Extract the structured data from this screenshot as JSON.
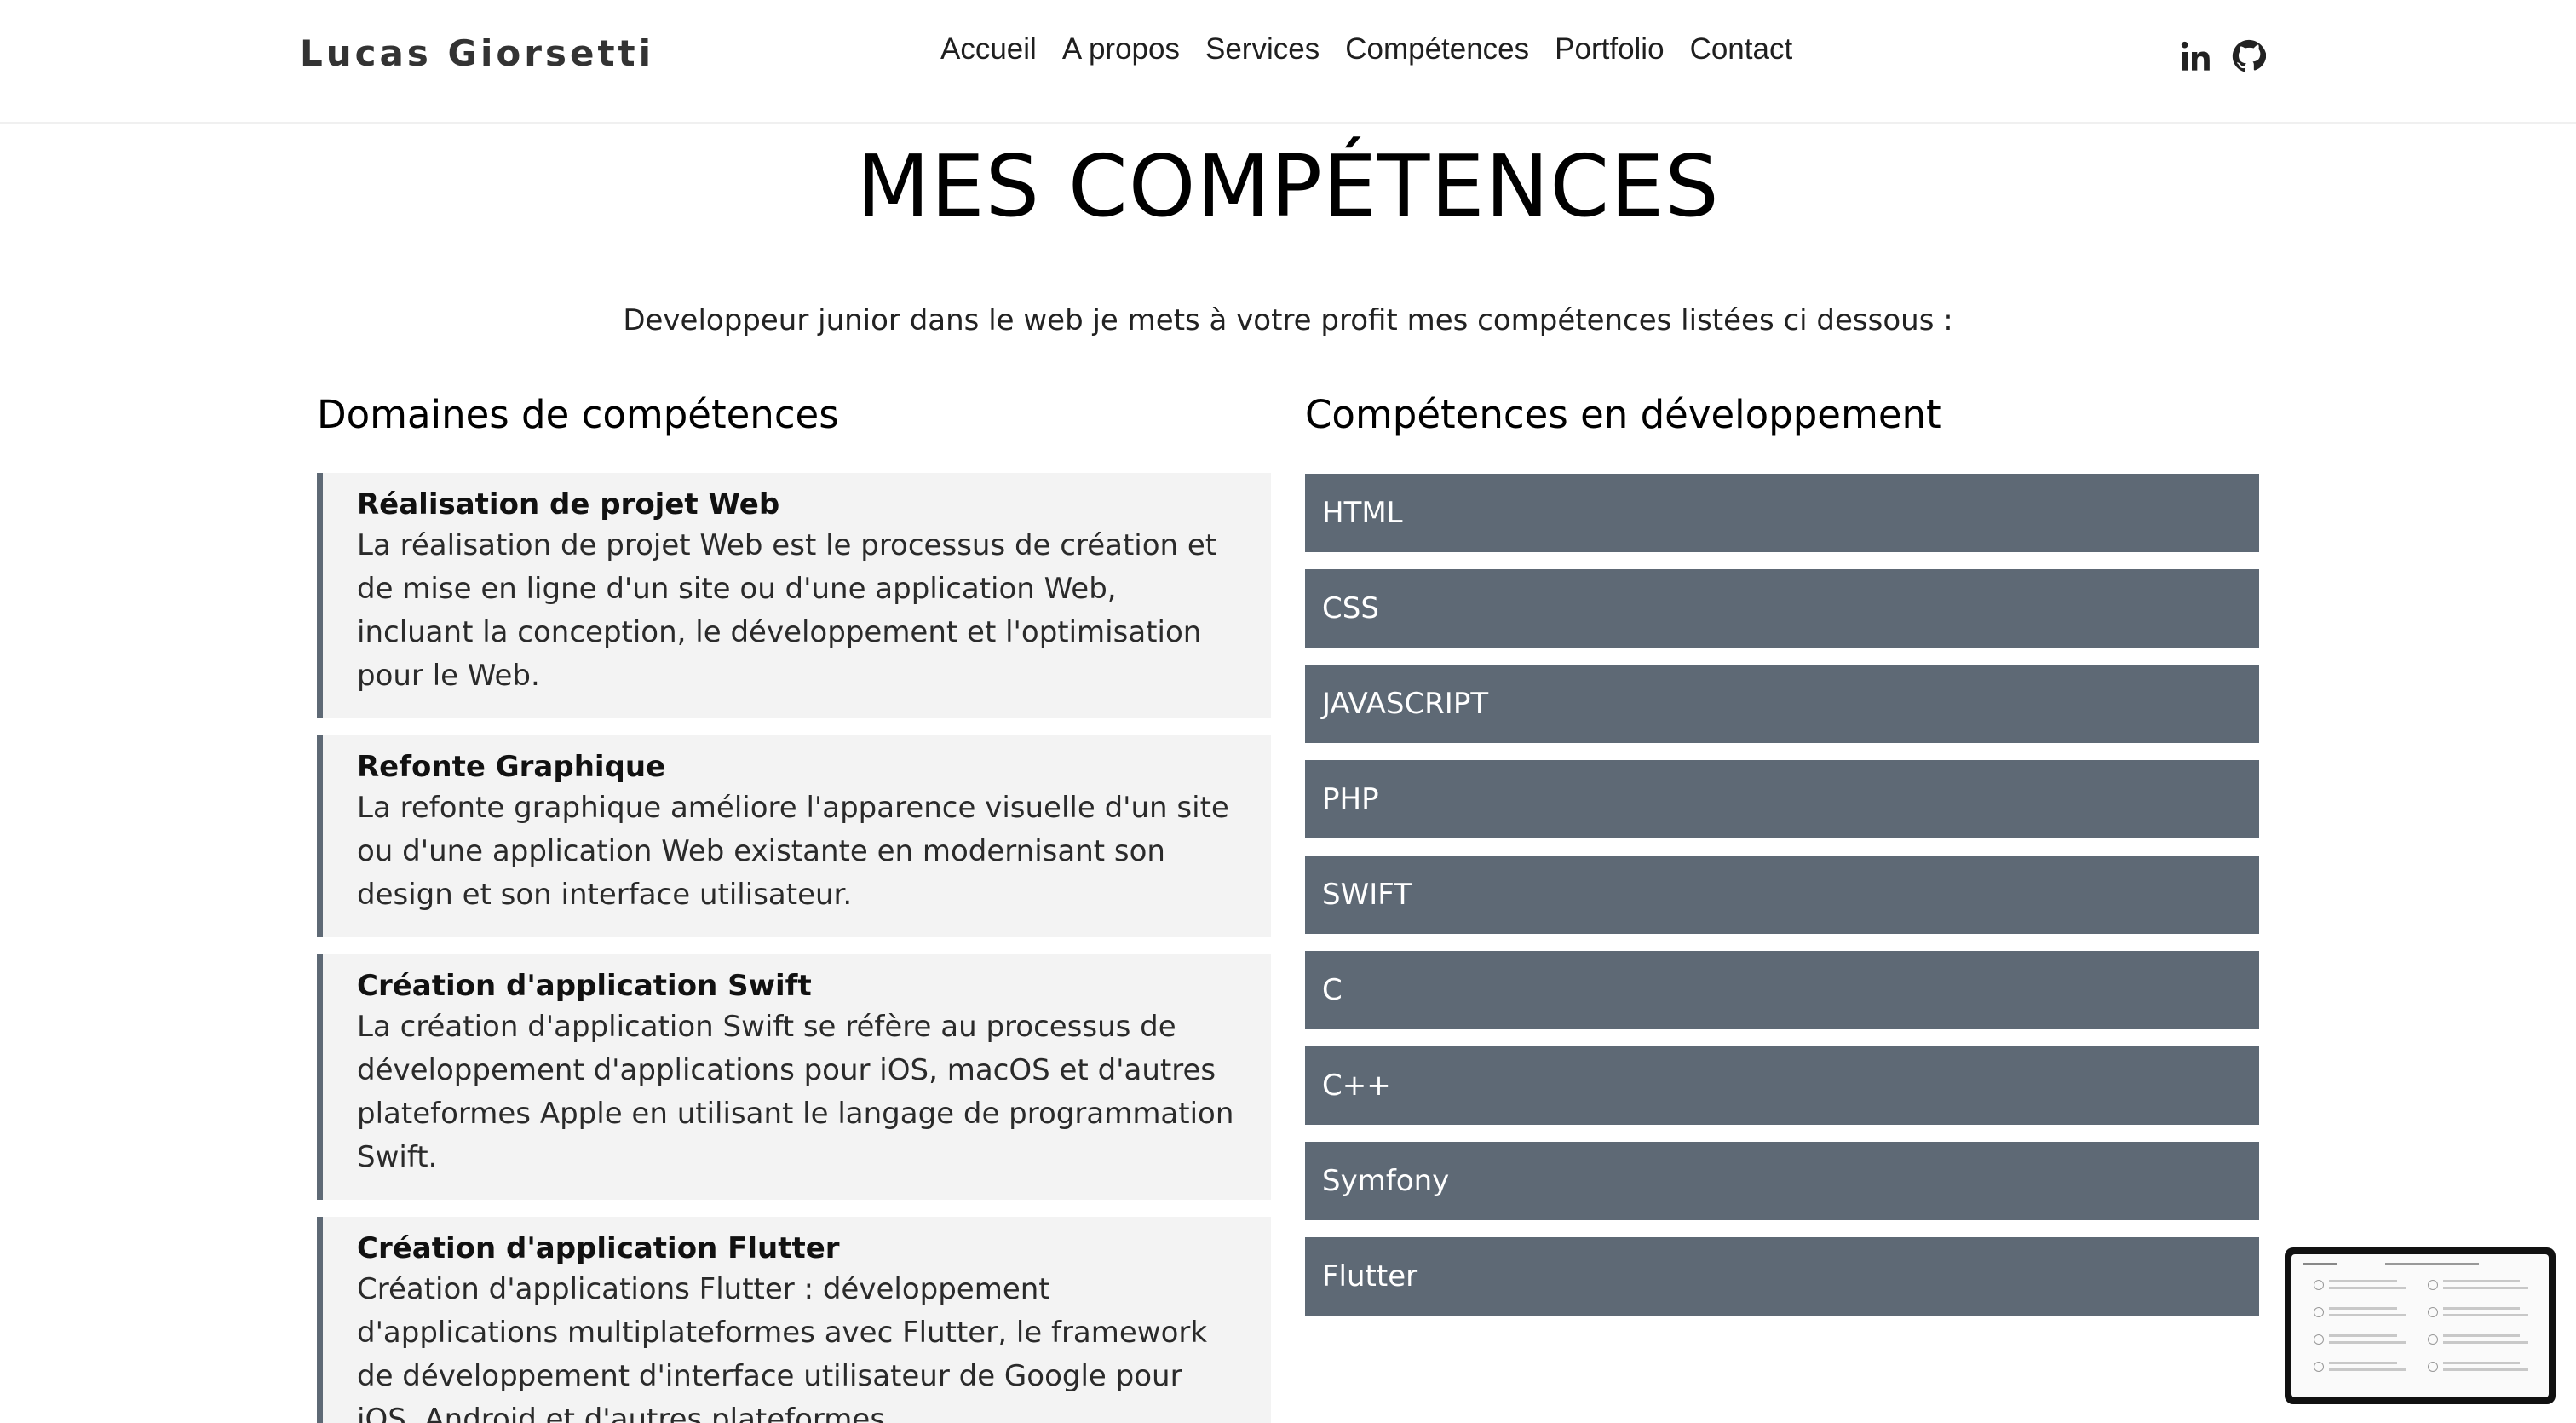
{
  "nav": {
    "brand": "Lucas Giorsetti",
    "links": [
      "Accueil",
      "A propos",
      "Services",
      "Compétences",
      "Portfolio",
      "Contact"
    ],
    "social_icons": [
      "linkedin-icon",
      "github-icon"
    ]
  },
  "page": {
    "title": "MES COMPÉTENCES",
    "intro": "Developpeur junior dans le web je mets à votre profit mes compétences listées ci dessous :"
  },
  "domains": {
    "heading": "Domaines de compétences",
    "items": [
      {
        "title": "Réalisation de projet Web",
        "desc": "La réalisation de projet Web est le processus de création et de mise en ligne d'un site ou d'une application Web, incluant la conception, le développement et l'optimisation pour le Web."
      },
      {
        "title": "Refonte Graphique",
        "desc": "La refonte graphique améliore l'apparence visuelle d'un site ou d'une application Web existante en modernisant son design et son interface utilisateur."
      },
      {
        "title": "Création d'application Swift",
        "desc": "La création d'application Swift se réfère au processus de développement d'applications pour iOS, macOS et d'autres plateformes Apple en utilisant le langage de programmation Swift."
      },
      {
        "title": "Création d'application Flutter",
        "desc": "Création d'applications Flutter : développement d'applications multiplateformes avec Flutter, le framework de développement d'interface utilisateur de Google pour iOS, Android et d'autres plateformes."
      }
    ]
  },
  "skills": {
    "heading": "Compétences en développement",
    "items": [
      "HTML",
      "CSS",
      "JAVASCRIPT",
      "PHP",
      "SWIFT",
      "C",
      "C++",
      "Symfony",
      "Flutter"
    ]
  },
  "colors": {
    "skill_bar": "#5e6975",
    "card_bg": "#f3f3f3",
    "card_border": "#5e6975"
  }
}
